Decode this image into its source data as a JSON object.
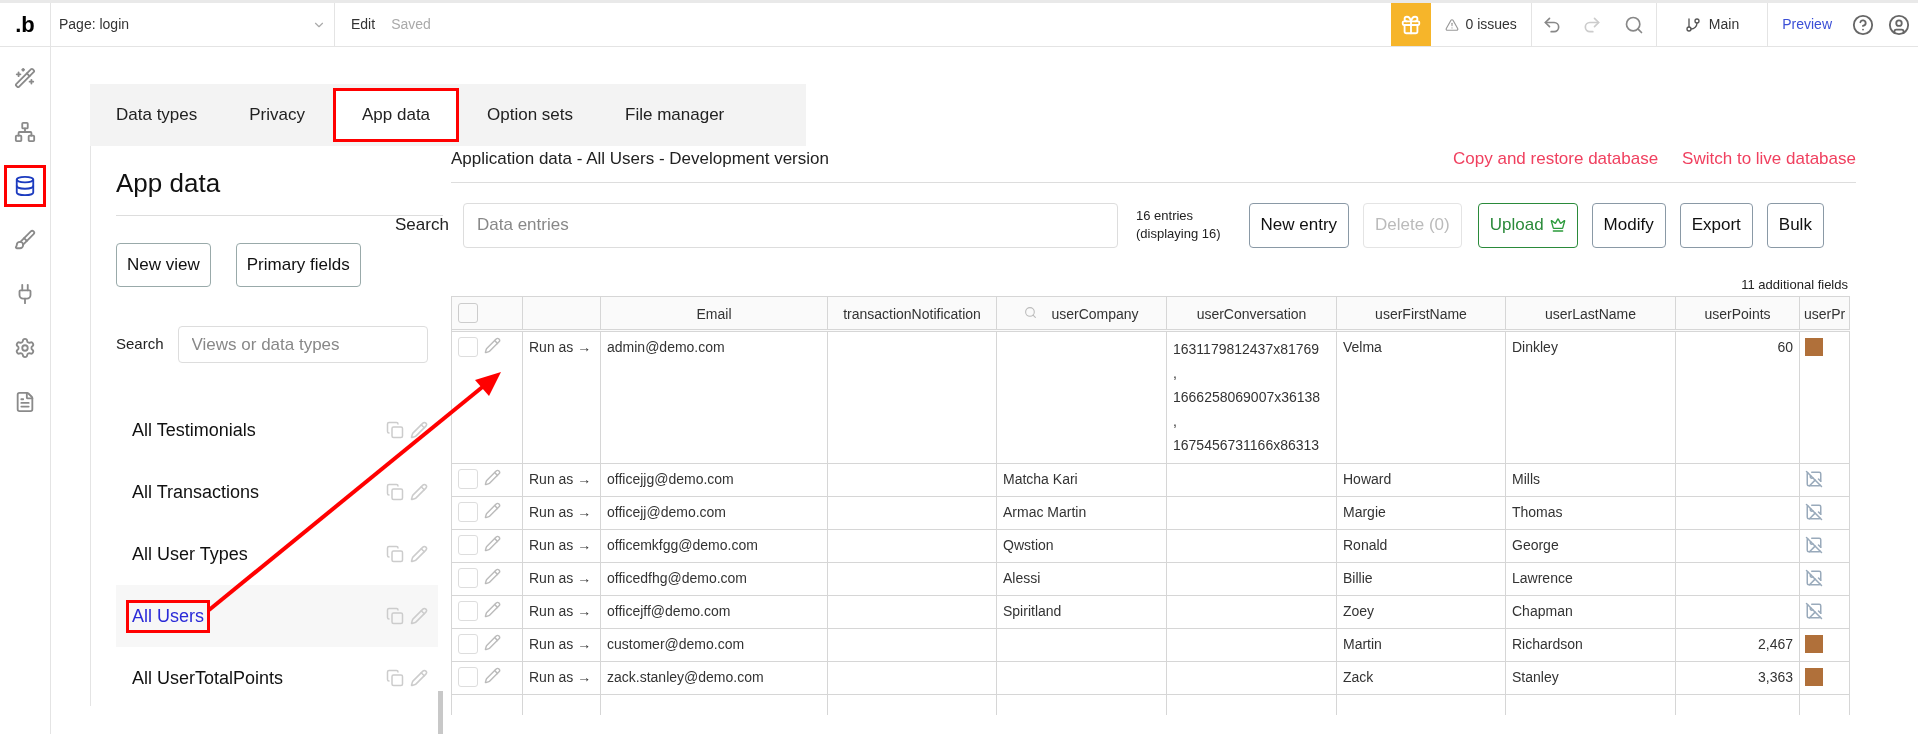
{
  "topbar": {
    "logo": ".b",
    "page_selector": "Page: login",
    "edit": "Edit",
    "saved": "Saved",
    "issues": "0 issues",
    "branch": "Main",
    "preview": "Preview"
  },
  "rail": [
    {
      "selected": false,
      "annotated": false
    },
    {
      "selected": false,
      "annotated": false
    },
    {
      "selected": true,
      "annotated": true
    },
    {
      "selected": false,
      "annotated": false
    },
    {
      "selected": false,
      "annotated": false
    },
    {
      "selected": false,
      "annotated": false
    },
    {
      "selected": false,
      "annotated": false
    }
  ],
  "tabs": [
    {
      "label": "Data types",
      "selected": false,
      "annotated": false
    },
    {
      "label": "Privacy",
      "selected": false,
      "annotated": false
    },
    {
      "label": "App data",
      "selected": true,
      "annotated": true
    },
    {
      "label": "Option sets",
      "selected": false,
      "annotated": false
    },
    {
      "label": "File manager",
      "selected": false,
      "annotated": false
    }
  ],
  "heading": "App data",
  "subheading": "Application data - All Users - Development version",
  "links": [
    "Copy and restore database",
    "Switch to live database"
  ],
  "buttons_left": [
    "New view",
    "Primary fields"
  ],
  "search_label": "Search",
  "search": {
    "placeholder": "Data entries"
  },
  "entries": [
    "16 entries",
    "(displaying 16)"
  ],
  "actions": [
    {
      "label": "New entry",
      "kind": "plain",
      "disabled": false
    },
    {
      "label": "Delete (0)",
      "kind": "plain",
      "disabled": true
    },
    {
      "label": "Upload",
      "kind": "upload",
      "disabled": false
    },
    {
      "label": "Modify",
      "kind": "plain",
      "disabled": false
    },
    {
      "label": "Export",
      "kind": "plain",
      "disabled": false
    },
    {
      "label": "Bulk",
      "kind": "plain",
      "disabled": false
    }
  ],
  "additional_fields": "11 additional fields",
  "sidebar": {
    "search_label": "Search",
    "search": {
      "placeholder": "Views or data types"
    },
    "items": [
      {
        "label": "All Testimonials",
        "selected": false,
        "annotated": false
      },
      {
        "label": "All Transactions",
        "selected": false,
        "annotated": false
      },
      {
        "label": "All User Types",
        "selected": false,
        "annotated": false
      },
      {
        "label": "All Users",
        "selected": true,
        "annotated": true
      },
      {
        "label": "All UserTotalPoints",
        "selected": false,
        "annotated": false
      }
    ]
  },
  "table": {
    "columns": [
      "Email",
      "transactionNotification",
      "userCompany",
      "userConversation",
      "userFirstName",
      "userLastName",
      "userPoints",
      "userPr"
    ],
    "select_all": {
      "checked": false
    },
    "rows": [
      {
        "checked": false,
        "run_as": "Run as →",
        "email": "admin@demo.com",
        "company": "",
        "conversation": [
          "1631179812437x81769",
          ",",
          "1666258069007x36138",
          ",",
          "1675456731166x86313"
        ],
        "first": "Velma",
        "last": "Dinkley",
        "points": "60",
        "picture": {
          "kind": "photo"
        }
      },
      {
        "checked": false,
        "run_as": "Run as →",
        "email": "officejjg@demo.com",
        "company": "Matcha Kari",
        "conversation": [],
        "first": "Howard",
        "last": "Mills",
        "points": "",
        "picture": {
          "kind": "broken"
        }
      },
      {
        "checked": false,
        "run_as": "Run as →",
        "email": "officejj@demo.com",
        "company": "Armac Martin",
        "conversation": [],
        "first": "Margie",
        "last": "Thomas",
        "points": "",
        "picture": {
          "kind": "broken"
        }
      },
      {
        "checked": false,
        "run_as": "Run as →",
        "email": "officemkfgg@demo.com",
        "company": "Qwstion",
        "conversation": [],
        "first": "Ronald",
        "last": "George",
        "points": "",
        "picture": {
          "kind": "broken"
        }
      },
      {
        "checked": false,
        "run_as": "Run as →",
        "email": "officedfhg@demo.com",
        "company": "Alessi",
        "conversation": [],
        "first": "Billie",
        "last": "Lawrence",
        "points": "",
        "picture": {
          "kind": "broken"
        }
      },
      {
        "checked": false,
        "run_as": "Run as →",
        "email": "officejff@demo.com",
        "company": "Spiritland",
        "conversation": [],
        "first": "Zoey",
        "last": "Chapman",
        "points": "",
        "picture": {
          "kind": "broken"
        }
      },
      {
        "checked": false,
        "run_as": "Run as →",
        "email": "customer@demo.com",
        "company": "",
        "conversation": [],
        "first": "Martin",
        "last": "Richardson",
        "points": "2,467",
        "picture": {
          "kind": "photo"
        }
      },
      {
        "checked": false,
        "run_as": "Run as →",
        "email": "zack.stanley@demo.com",
        "company": "",
        "conversation": [],
        "first": "Zack",
        "last": "Stanley",
        "points": "3,363",
        "picture": {
          "kind": "photo"
        }
      }
    ]
  }
}
